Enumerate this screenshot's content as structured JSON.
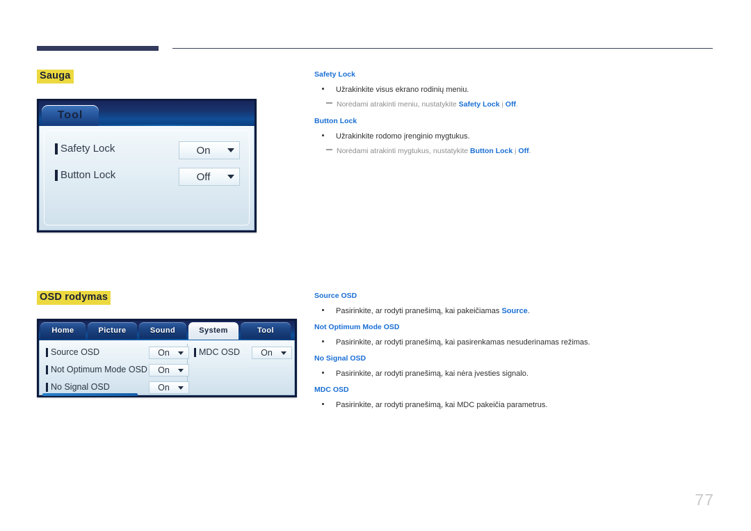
{
  "page": {
    "number": "77",
    "language": "lt"
  },
  "colors": {
    "heading_highlight": "#ecd93f",
    "keyword_blue": "#1a6fd4",
    "rule_navy": "#343a5e",
    "note_gray": "#8d8d8d"
  },
  "sections": [
    {
      "id": "sauga",
      "heading": "Sauga",
      "panel": {
        "type": "single-tab",
        "tabs": [
          {
            "label": "Tool",
            "active": true
          }
        ],
        "rows": [
          {
            "label": "Safety Lock",
            "value": "On"
          },
          {
            "label": "Button Lock",
            "value": "Off"
          }
        ]
      },
      "entries": [
        {
          "title": "Safety Lock",
          "bullet": "Užrakinkite visus ekrano rodinių meniu.",
          "note": {
            "prefix": "Norėdami atrakinti meniu, nustatykite ",
            "kw1": "Safety Lock",
            "sep": " į ",
            "kw2": "Off",
            "suffix": "."
          }
        },
        {
          "title": "Button Lock",
          "bullet": "Užrakinkite rodomo įrenginio mygtukus.",
          "note": {
            "prefix": "Norėdami atrakinti mygtukus, nustatykite ",
            "kw1": "Button Lock",
            "sep": " į ",
            "kw2": "Off",
            "suffix": "."
          }
        }
      ]
    },
    {
      "id": "osd-rodymas",
      "heading": "OSD rodymas",
      "panel": {
        "type": "multi-tab",
        "tabs": [
          {
            "label": "Home",
            "active": false
          },
          {
            "label": "Picture",
            "active": false
          },
          {
            "label": "Sound",
            "active": false
          },
          {
            "label": "System",
            "active": true
          },
          {
            "label": "Tool",
            "active": false
          }
        ],
        "rows_left": [
          {
            "label": "Source OSD",
            "value": "On"
          },
          {
            "label": "Not Optimum Mode OSD",
            "value": "On"
          },
          {
            "label": "No Signal OSD",
            "value": "On"
          }
        ],
        "rows_right": [
          {
            "label": "MDC OSD",
            "value": "On"
          }
        ]
      },
      "entries": [
        {
          "title": "Source OSD",
          "bullet_prefix": "Pasirinkite, ar rodyti pranešimą, kai pakeičiamas ",
          "bullet_kw": "Source",
          "bullet_suffix": "."
        },
        {
          "title": "Not Optimum Mode OSD",
          "bullet": "Pasirinkite, ar rodyti pranešimą, kai pasirenkamas nesuderinamas režimas."
        },
        {
          "title": "No Signal OSD",
          "bullet": "Pasirinkite, ar rodyti pranešimą, kai nėra įvesties signalo."
        },
        {
          "title": "MDC OSD",
          "bullet": "Pasirinkite, ar rodyti pranešimą, kai MDC pakeičia parametrus."
        }
      ]
    }
  ]
}
